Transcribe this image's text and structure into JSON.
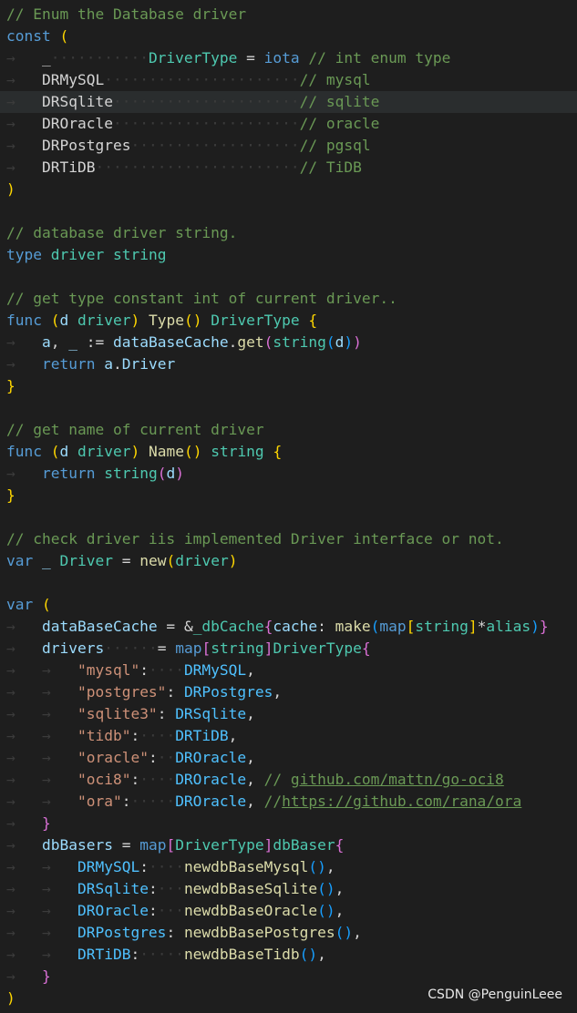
{
  "editor": {
    "language": "go",
    "lines": [
      [
        [
          "// Enum the Database driver",
          "c-comment"
        ]
      ],
      [
        [
          "const",
          "c-kw"
        ],
        [
          " ",
          "ws"
        ],
        [
          "(",
          "c-paren1"
        ]
      ],
      [
        [
          "→   ",
          "ws"
        ],
        [
          "_",
          "c-plain"
        ],
        [
          "···········",
          "ws"
        ],
        [
          "DriverType",
          "c-type"
        ],
        [
          " = ",
          "c-plain"
        ],
        [
          "iota",
          "c-kw"
        ],
        [
          " ",
          "ws"
        ],
        [
          "// int enum type",
          "c-comment"
        ]
      ],
      [
        [
          "→   ",
          "ws"
        ],
        [
          "DRMySQL",
          "c-plain"
        ],
        [
          "······················",
          "ws"
        ],
        [
          "// mysql",
          "c-comment"
        ]
      ],
      [
        [
          "→   ",
          "ws"
        ],
        [
          "DRSqlite",
          "c-plain"
        ],
        [
          "·····················",
          "ws"
        ],
        [
          "// sqlite",
          "c-comment"
        ]
      ],
      [
        [
          "→   ",
          "ws"
        ],
        [
          "DROracle",
          "c-plain"
        ],
        [
          "·····················",
          "ws"
        ],
        [
          "// oracle",
          "c-comment"
        ]
      ],
      [
        [
          "→   ",
          "ws"
        ],
        [
          "DRPostgres",
          "c-plain"
        ],
        [
          "···················",
          "ws"
        ],
        [
          "// pgsql",
          "c-comment"
        ]
      ],
      [
        [
          "→   ",
          "ws"
        ],
        [
          "DRTiDB",
          "c-plain"
        ],
        [
          "·······················",
          "ws"
        ],
        [
          "// TiDB",
          "c-comment"
        ]
      ],
      [
        [
          ")",
          "c-paren1"
        ]
      ],
      [],
      [
        [
          "// database driver string.",
          "c-comment"
        ]
      ],
      [
        [
          "type",
          "c-kw"
        ],
        [
          " ",
          "ws"
        ],
        [
          "driver",
          "c-type"
        ],
        [
          " ",
          "ws"
        ],
        [
          "string",
          "c-type"
        ]
      ],
      [],
      [
        [
          "// get type constant int of current driver..",
          "c-comment"
        ]
      ],
      [
        [
          "func",
          "c-kw"
        ],
        [
          " ",
          "ws"
        ],
        [
          "(",
          "c-paren1"
        ],
        [
          "d",
          "c-var"
        ],
        [
          " ",
          "ws"
        ],
        [
          "driver",
          "c-type"
        ],
        [
          ")",
          "c-paren1"
        ],
        [
          " ",
          "ws"
        ],
        [
          "Type",
          "c-func"
        ],
        [
          "()",
          "c-paren1"
        ],
        [
          " ",
          "ws"
        ],
        [
          "DriverType",
          "c-type"
        ],
        [
          " ",
          "ws"
        ],
        [
          "{",
          "c-paren1"
        ]
      ],
      [
        [
          "→   ",
          "ws"
        ],
        [
          "a",
          "c-var"
        ],
        [
          ", ",
          "c-plain"
        ],
        [
          "_",
          "c-var"
        ],
        [
          " := ",
          "c-plain"
        ],
        [
          "dataBaseCache",
          "c-var"
        ],
        [
          ".",
          "c-plain"
        ],
        [
          "get",
          "c-func"
        ],
        [
          "(",
          "c-paren2"
        ],
        [
          "string",
          "c-type"
        ],
        [
          "(",
          "c-paren3"
        ],
        [
          "d",
          "c-var"
        ],
        [
          ")",
          "c-paren3"
        ],
        [
          ")",
          "c-paren2"
        ]
      ],
      [
        [
          "→   ",
          "ws"
        ],
        [
          "return",
          "c-kw"
        ],
        [
          " ",
          "ws"
        ],
        [
          "a",
          "c-var"
        ],
        [
          ".",
          "c-plain"
        ],
        [
          "Driver",
          "c-var"
        ]
      ],
      [
        [
          "}",
          "c-paren1"
        ]
      ],
      [],
      [
        [
          "// get name of current driver",
          "c-comment"
        ]
      ],
      [
        [
          "func",
          "c-kw"
        ],
        [
          " ",
          "ws"
        ],
        [
          "(",
          "c-paren1"
        ],
        [
          "d",
          "c-var"
        ],
        [
          " ",
          "ws"
        ],
        [
          "driver",
          "c-type"
        ],
        [
          ")",
          "c-paren1"
        ],
        [
          " ",
          "ws"
        ],
        [
          "Name",
          "c-func"
        ],
        [
          "()",
          "c-paren1"
        ],
        [
          " ",
          "ws"
        ],
        [
          "string",
          "c-type"
        ],
        [
          " ",
          "ws"
        ],
        [
          "{",
          "c-paren1"
        ]
      ],
      [
        [
          "→   ",
          "ws"
        ],
        [
          "return",
          "c-kw"
        ],
        [
          " ",
          "ws"
        ],
        [
          "string",
          "c-type"
        ],
        [
          "(",
          "c-paren2"
        ],
        [
          "d",
          "c-var"
        ],
        [
          ")",
          "c-paren2"
        ]
      ],
      [
        [
          "}",
          "c-paren1"
        ]
      ],
      [],
      [
        [
          "// check driver iis implemented Driver interface or not.",
          "c-comment"
        ]
      ],
      [
        [
          "var",
          "c-kw"
        ],
        [
          " ",
          "ws"
        ],
        [
          "_",
          "c-var"
        ],
        [
          " ",
          "ws"
        ],
        [
          "Driver",
          "c-type"
        ],
        [
          " = ",
          "c-plain"
        ],
        [
          "new",
          "c-func"
        ],
        [
          "(",
          "c-paren1"
        ],
        [
          "driver",
          "c-type"
        ],
        [
          ")",
          "c-paren1"
        ]
      ],
      [],
      [
        [
          "var",
          "c-kw"
        ],
        [
          " ",
          "ws"
        ],
        [
          "(",
          "c-paren1"
        ]
      ],
      [
        [
          "→   ",
          "ws"
        ],
        [
          "dataBaseCache",
          "c-var"
        ],
        [
          " = ",
          "c-plain"
        ],
        [
          "&",
          "c-plain"
        ],
        [
          "_dbCache",
          "c-type"
        ],
        [
          "{",
          "c-paren2"
        ],
        [
          "cache",
          "c-var"
        ],
        [
          ": ",
          "c-plain"
        ],
        [
          "make",
          "c-func"
        ],
        [
          "(",
          "c-paren3"
        ],
        [
          "map",
          "c-kw"
        ],
        [
          "[",
          "c-paren1"
        ],
        [
          "string",
          "c-type"
        ],
        [
          "]",
          "c-paren1"
        ],
        [
          "*",
          "c-plain"
        ],
        [
          "alias",
          "c-type"
        ],
        [
          ")",
          "c-paren3"
        ],
        [
          "}",
          "c-paren2"
        ]
      ],
      [
        [
          "→   ",
          "ws"
        ],
        [
          "drivers",
          "c-var"
        ],
        [
          "······",
          "ws"
        ],
        [
          "= ",
          "c-plain"
        ],
        [
          "map",
          "c-kw"
        ],
        [
          "[",
          "c-paren2"
        ],
        [
          "string",
          "c-type"
        ],
        [
          "]",
          "c-paren2"
        ],
        [
          "DriverType",
          "c-type"
        ],
        [
          "{",
          "c-paren2"
        ]
      ],
      [
        [
          "→   →   ",
          "ws"
        ],
        [
          "\"mysql\"",
          "c-str"
        ],
        [
          ":",
          "c-plain"
        ],
        [
          "····",
          "ws"
        ],
        [
          "DRMySQL",
          "c-const"
        ],
        [
          ",",
          "c-plain"
        ]
      ],
      [
        [
          "→   →   ",
          "ws"
        ],
        [
          "\"postgres\"",
          "c-str"
        ],
        [
          ": ",
          "c-plain"
        ],
        [
          "DRPostgres",
          "c-const"
        ],
        [
          ",",
          "c-plain"
        ]
      ],
      [
        [
          "→   →   ",
          "ws"
        ],
        [
          "\"sqlite3\"",
          "c-str"
        ],
        [
          ": ",
          "c-plain"
        ],
        [
          "DRSqlite",
          "c-const"
        ],
        [
          ",",
          "c-plain"
        ]
      ],
      [
        [
          "→   →   ",
          "ws"
        ],
        [
          "\"tidb\"",
          "c-str"
        ],
        [
          ":",
          "c-plain"
        ],
        [
          "····",
          "ws"
        ],
        [
          "DRTiDB",
          "c-const"
        ],
        [
          ",",
          "c-plain"
        ]
      ],
      [
        [
          "→   →   ",
          "ws"
        ],
        [
          "\"oracle\"",
          "c-str"
        ],
        [
          ":",
          "c-plain"
        ],
        [
          "··",
          "ws"
        ],
        [
          "DROracle",
          "c-const"
        ],
        [
          ",",
          "c-plain"
        ]
      ],
      [
        [
          "→   →   ",
          "ws"
        ],
        [
          "\"oci8\"",
          "c-str"
        ],
        [
          ":",
          "c-plain"
        ],
        [
          "····",
          "ws"
        ],
        [
          "DROracle",
          "c-const"
        ],
        [
          ", ",
          "c-plain"
        ],
        [
          "// ",
          "c-comment"
        ],
        [
          "github.com/mattn/go-oci8",
          "c-link"
        ]
      ],
      [
        [
          "→   →   ",
          "ws"
        ],
        [
          "\"ora\"",
          "c-str"
        ],
        [
          ":",
          "c-plain"
        ],
        [
          "·····",
          "ws"
        ],
        [
          "DROracle",
          "c-const"
        ],
        [
          ", ",
          "c-plain"
        ],
        [
          "//",
          "c-comment"
        ],
        [
          "https://github.com/rana/ora",
          "c-link"
        ]
      ],
      [
        [
          "→   ",
          "ws"
        ],
        [
          "}",
          "c-paren2"
        ]
      ],
      [
        [
          "→   ",
          "ws"
        ],
        [
          "dbBasers",
          "c-var"
        ],
        [
          " = ",
          "c-plain"
        ],
        [
          "map",
          "c-kw"
        ],
        [
          "[",
          "c-paren2"
        ],
        [
          "DriverType",
          "c-type"
        ],
        [
          "]",
          "c-paren2"
        ],
        [
          "dbBaser",
          "c-type"
        ],
        [
          "{",
          "c-paren2"
        ]
      ],
      [
        [
          "→   →   ",
          "ws"
        ],
        [
          "DRMySQL",
          "c-const"
        ],
        [
          ":",
          "c-plain"
        ],
        [
          "····",
          "ws"
        ],
        [
          "newdbBaseMysql",
          "c-func"
        ],
        [
          "()",
          "c-paren3"
        ],
        [
          ",",
          "c-plain"
        ]
      ],
      [
        [
          "→   →   ",
          "ws"
        ],
        [
          "DRSqlite",
          "c-const"
        ],
        [
          ":",
          "c-plain"
        ],
        [
          "···",
          "ws"
        ],
        [
          "newdbBaseSqlite",
          "c-func"
        ],
        [
          "()",
          "c-paren3"
        ],
        [
          ",",
          "c-plain"
        ]
      ],
      [
        [
          "→   →   ",
          "ws"
        ],
        [
          "DROracle",
          "c-const"
        ],
        [
          ":",
          "c-plain"
        ],
        [
          "···",
          "ws"
        ],
        [
          "newdbBaseOracle",
          "c-func"
        ],
        [
          "()",
          "c-paren3"
        ],
        [
          ",",
          "c-plain"
        ]
      ],
      [
        [
          "→   →   ",
          "ws"
        ],
        [
          "DRPostgres",
          "c-const"
        ],
        [
          ": ",
          "c-plain"
        ],
        [
          "newdbBasePostgres",
          "c-func"
        ],
        [
          "()",
          "c-paren3"
        ],
        [
          ",",
          "c-plain"
        ]
      ],
      [
        [
          "→   →   ",
          "ws"
        ],
        [
          "DRTiDB",
          "c-const"
        ],
        [
          ":",
          "c-plain"
        ],
        [
          "·····",
          "ws"
        ],
        [
          "newdbBaseTidb",
          "c-func"
        ],
        [
          "()",
          "c-paren3"
        ],
        [
          ",",
          "c-plain"
        ]
      ],
      [
        [
          "→   ",
          "ws"
        ],
        [
          "}",
          "c-paren2"
        ]
      ],
      [
        [
          ")",
          "c-paren1"
        ]
      ]
    ]
  },
  "watermark": "CSDN @PenguinLeee"
}
